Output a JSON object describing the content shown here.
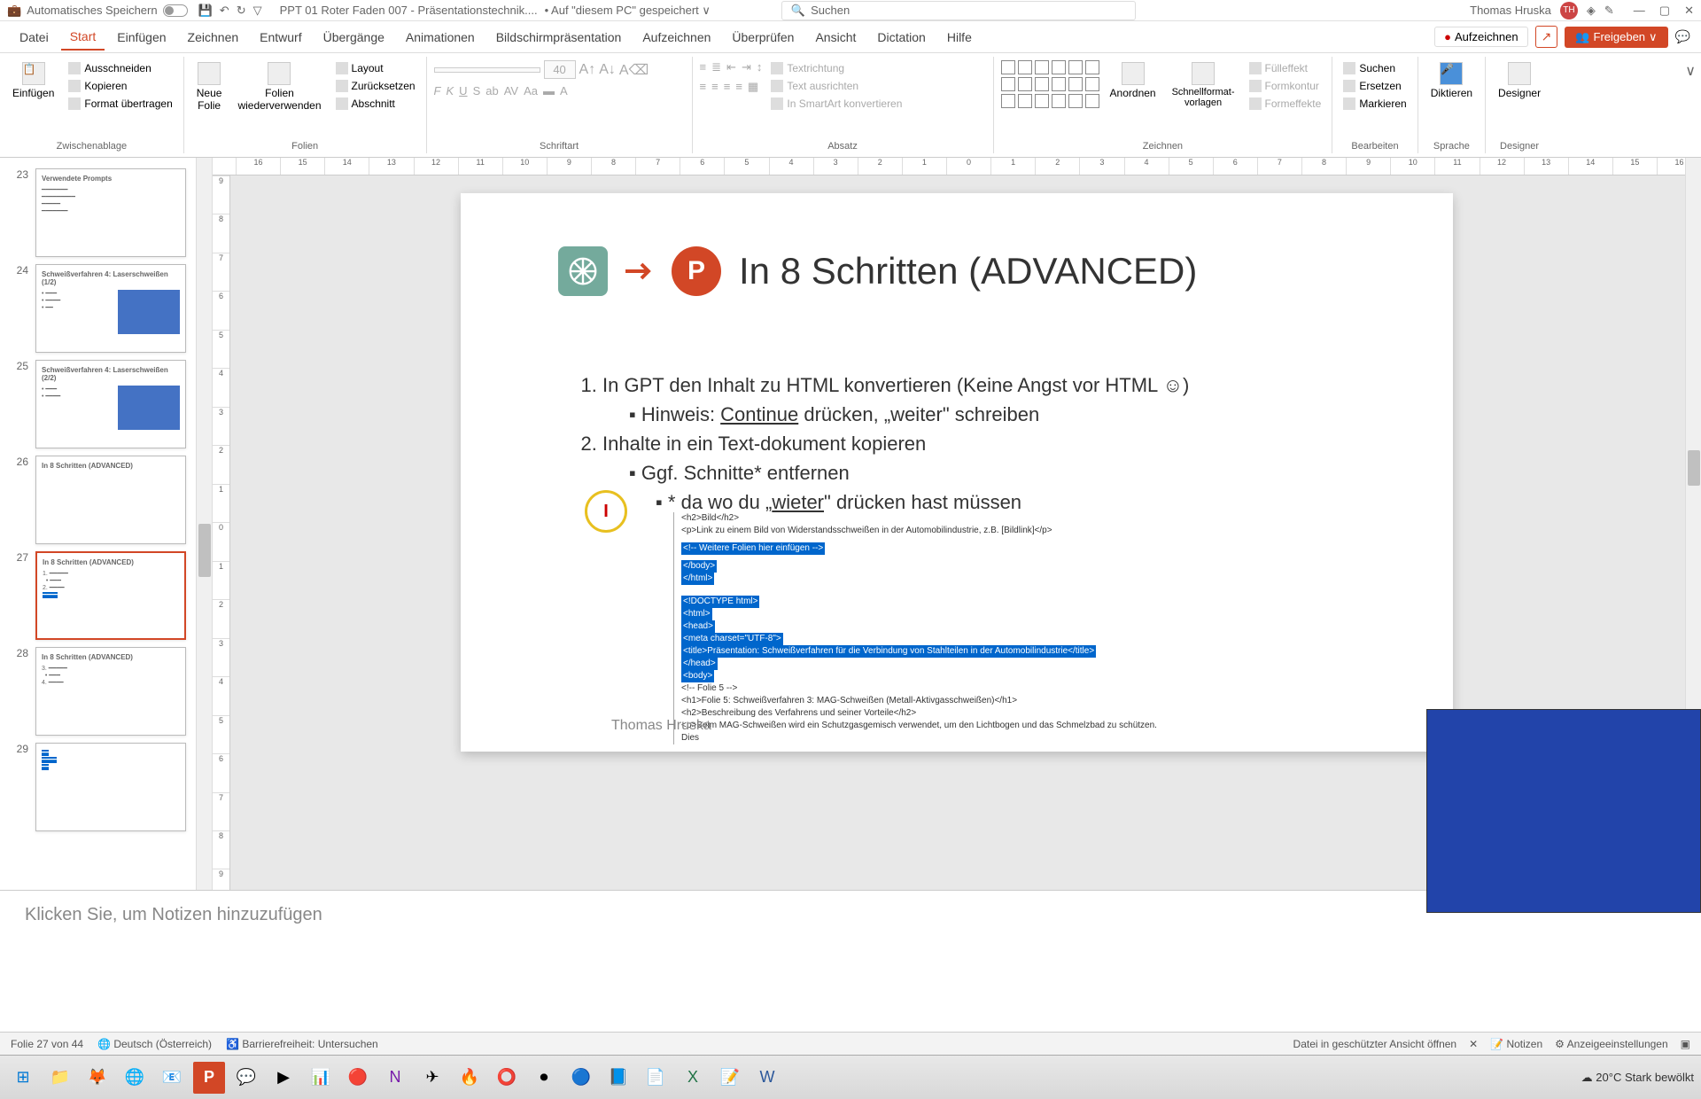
{
  "titlebar": {
    "autosave": "Automatisches Speichern",
    "filename": "PPT 01 Roter Faden 007 - Präsentationstechnik....",
    "saved": "• Auf \"diesem PC\" gespeichert ∨",
    "search": "Suchen",
    "user": "Thomas Hruska",
    "initials": "TH"
  },
  "tabs": [
    "Datei",
    "Start",
    "Einfügen",
    "Zeichnen",
    "Entwurf",
    "Übergänge",
    "Animationen",
    "Bildschirmpräsentation",
    "Aufzeichnen",
    "Überprüfen",
    "Ansicht",
    "Dictation",
    "Hilfe"
  ],
  "tabs_right": {
    "record": "Aufzeichnen",
    "share": "Freigeben"
  },
  "ribbon": {
    "clipboard": {
      "label": "Zwischenablage",
      "paste": "Einfügen",
      "cut": "Ausschneiden",
      "copy": "Kopieren",
      "format": "Format übertragen"
    },
    "slides": {
      "label": "Folien",
      "new": "Neue\nFolie",
      "reuse": "Folien\nwiederverwenden",
      "layout": "Layout",
      "reset": "Zurücksetzen",
      "section": "Abschnitt"
    },
    "font": {
      "label": "Schriftart",
      "size": "40"
    },
    "para": {
      "label": "Absatz",
      "dir": "Textrichtung",
      "align": "Text ausrichten",
      "smart": "In SmartArt konvertieren"
    },
    "draw": {
      "label": "Zeichnen",
      "arrange": "Anordnen",
      "quickformat": "Schnellformat-\nvorlagen",
      "fill": "Fülleffekt",
      "outline": "Formkontur",
      "effects": "Formeffekte"
    },
    "edit": {
      "label": "Bearbeiten",
      "find": "Suchen",
      "replace": "Ersetzen",
      "select": "Markieren"
    },
    "voice": {
      "label": "Sprache",
      "dictate": "Diktieren"
    },
    "designer": {
      "label": "Designer",
      "btn": "Designer"
    }
  },
  "thumbs": [
    {
      "n": "23",
      "title": "Verwendete Prompts"
    },
    {
      "n": "24",
      "title": "Schweißverfahren 4: Laserschweißen (1/2)"
    },
    {
      "n": "25",
      "title": "Schweißverfahren 4: Laserschweißen (2/2)"
    },
    {
      "n": "26",
      "title": "In 8 Schritten (ADVANCED)"
    },
    {
      "n": "27",
      "title": "In 8 Schritten (ADVANCED)"
    },
    {
      "n": "28",
      "title": "In 8 Schritten (ADVANCED)"
    },
    {
      "n": "29",
      "title": ""
    }
  ],
  "slide": {
    "title": "In 8 Schritten  (ADVANCED)",
    "li1": "In GPT den Inhalt zu HTML konvertieren (Keine Angst vor HTML ☺)",
    "li1a": "Hinweis: ",
    "li1a_u": "Continue",
    "li1a_rest": " drücken, „weiter\" schreiben",
    "li2": "Inhalte in ein Text-dokument kopieren",
    "li2a": "Ggf. Schnitte* entfernen",
    "li2b": "* da wo du „",
    "li2b_u": "wieter",
    "li2b_rest": "\" drücken hast müssen",
    "code1": "<h2>Bild</h2>",
    "code2": "<p>Link zu einem Bild von Widerstandsschweißen in der Automobilindustrie, z.B. [Bildlink]</p>",
    "code3": "<!-- Weitere Folien hier einfügen -->",
    "code4": "</body>",
    "code5": "</html>",
    "code6": "<!DOCTYPE html>",
    "code7": "<html>",
    "code8": "<head>",
    "code9": "    <meta charset=\"UTF-8\">",
    "code10": "    <title>Präsentation: Schweißverfahren für die Verbindung von Stahlteilen in der Automobilindustrie</title>",
    "code11": "</head>",
    "code12": "<body>",
    "code13": "<!-- Folie 5 -->",
    "code14": "<h1>Folie 5: Schweißverfahren 3: MAG-Schweißen (Metall-Aktivgasschweißen)</h1>",
    "code15": "<h2>Beschreibung des Verfahrens und seiner Vorteile</h2>",
    "code16": "<p>Beim MAG-Schweißen wird ein Schutzgasgemisch verwendet, um den Lichtbogen und das Schmelzbad zu schützen. Dies",
    "footer": "Thomas Hruska"
  },
  "notes": "Klicken Sie, um Notizen hinzuzufügen",
  "status": {
    "slide": "Folie 27 von 44",
    "lang": "Deutsch (Österreich)",
    "a11y": "Barrierefreiheit: Untersuchen",
    "protected": "Datei in geschützter Ansicht öffnen",
    "notes": "Notizen",
    "display": "Anzeigeeinstellungen"
  },
  "taskbar": {
    "weather": "20°C  Stark bewölkt"
  },
  "ruler_h": [
    "16",
    "15",
    "14",
    "13",
    "12",
    "11",
    "10",
    "9",
    "8",
    "7",
    "6",
    "5",
    "4",
    "3",
    "2",
    "1",
    "0",
    "1",
    "2",
    "3",
    "4",
    "5",
    "6",
    "7",
    "8",
    "9",
    "10",
    "11",
    "12",
    "13",
    "14",
    "15",
    "16"
  ],
  "ruler_v": [
    "9",
    "8",
    "7",
    "6",
    "5",
    "4",
    "3",
    "2",
    "1",
    "0",
    "1",
    "2",
    "3",
    "4",
    "5",
    "6",
    "7",
    "8",
    "9"
  ]
}
